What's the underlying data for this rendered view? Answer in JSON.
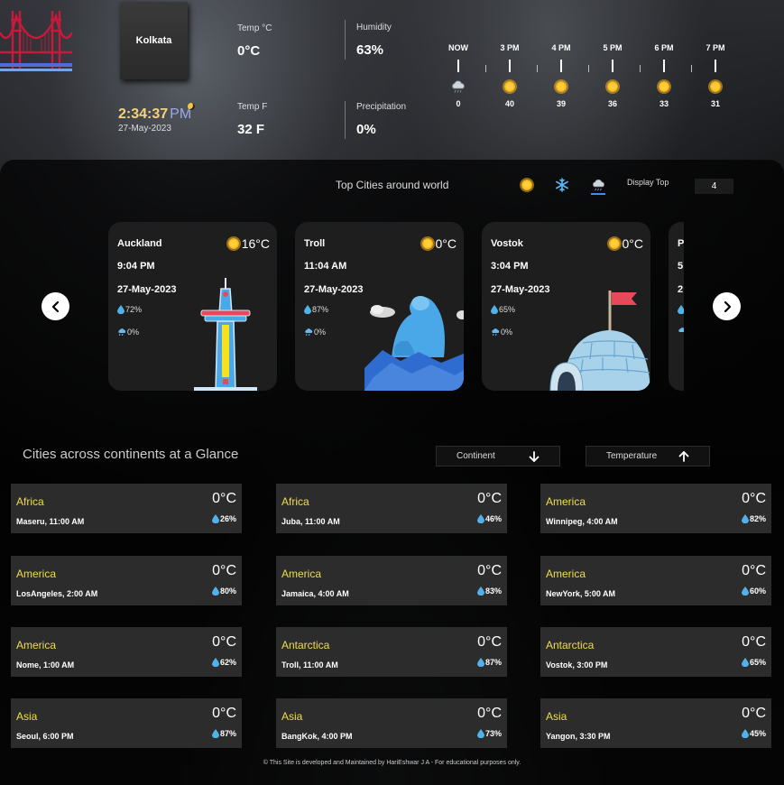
{
  "header": {
    "city": "Kolkata",
    "time": "2:34:37",
    "ampm": "PM",
    "date": "27-May-2023",
    "stats": [
      {
        "label": "Temp °C",
        "value": "0°C"
      },
      {
        "label": "Humidity",
        "value": "63%"
      },
      {
        "label": "Temp F",
        "value": "32 F"
      },
      {
        "label": "Precipitation",
        "value": "0%"
      }
    ],
    "hourly": [
      {
        "label": "NOW",
        "icon": "cloud-rain-icon",
        "value": "0"
      },
      {
        "label": "3 PM",
        "icon": "sun-icon",
        "value": "40"
      },
      {
        "label": "4 PM",
        "icon": "sun-icon",
        "value": "39"
      },
      {
        "label": "5 PM",
        "icon": "sun-icon",
        "value": "36"
      },
      {
        "label": "6 PM",
        "icon": "sun-icon",
        "value": "33"
      },
      {
        "label": "7 PM",
        "icon": "sun-icon",
        "value": "31"
      }
    ]
  },
  "top_cities": {
    "title": "Top Cities around world",
    "display_top_label": "Display Top",
    "display_top_value": "4",
    "cards": [
      {
        "city": "Auckland",
        "temp": "16°C",
        "time": "9:04 PM",
        "date": "27-May-2023",
        "humidity": "72%",
        "precip": "0%",
        "art": "sky-tower"
      },
      {
        "city": "Troll",
        "temp": "0°C",
        "time": "11:04 AM",
        "date": "27-May-2023",
        "humidity": "87%",
        "precip": "0%",
        "art": "polar-bear"
      },
      {
        "city": "Vostok",
        "temp": "0°C",
        "time": "3:04 PM",
        "date": "27-May-2023",
        "humidity": "65%",
        "precip": "0%",
        "art": "igloo"
      },
      {
        "city": "P",
        "temp": "",
        "time": "5",
        "date": "2",
        "humidity": "",
        "precip": "",
        "art": ""
      }
    ]
  },
  "glance": {
    "title": "Cities across continents at a Glance",
    "sort_continent": "Continent",
    "sort_temperature": "Temperature",
    "cities": [
      {
        "continent": "Africa",
        "temp": "0°C",
        "loc": "Maseru, 11:00 AM",
        "humidity": "26%"
      },
      {
        "continent": "Africa",
        "temp": "0°C",
        "loc": "Juba, 11:00 AM",
        "humidity": "46%"
      },
      {
        "continent": "America",
        "temp": "0°C",
        "loc": "Winnipeg, 4:00 AM",
        "humidity": "82%"
      },
      {
        "continent": "America",
        "temp": "0°C",
        "loc": "LosAngeles, 2:00 AM",
        "humidity": "80%"
      },
      {
        "continent": "America",
        "temp": "0°C",
        "loc": "Jamaica, 4:00 AM",
        "humidity": "83%"
      },
      {
        "continent": "America",
        "temp": "0°C",
        "loc": "NewYork, 5:00 AM",
        "humidity": "60%"
      },
      {
        "continent": "America",
        "temp": "0°C",
        "loc": "Nome, 1:00 AM",
        "humidity": "62%"
      },
      {
        "continent": "Antarctica",
        "temp": "0°C",
        "loc": "Troll, 11:00 AM",
        "humidity": "87%"
      },
      {
        "continent": "Antarctica",
        "temp": "0°C",
        "loc": "Vostok, 3:00 PM",
        "humidity": "65%"
      },
      {
        "continent": "Asia",
        "temp": "0°C",
        "loc": "Seoul, 6:00 PM",
        "humidity": "87%"
      },
      {
        "continent": "Asia",
        "temp": "0°C",
        "loc": "BangKok, 4:00 PM",
        "humidity": "73%"
      },
      {
        "continent": "Asia",
        "temp": "0°C",
        "loc": "Yangon, 3:30 PM",
        "humidity": "45%"
      }
    ]
  },
  "footer": "© This Site is developed and Maintained by HariEshwar J A - For educational purposes only.",
  "colors": {
    "continent": "#f0dc52",
    "time": "#f3d37e",
    "pm": "#9ca8e8",
    "accent": "#3f8fe8"
  }
}
